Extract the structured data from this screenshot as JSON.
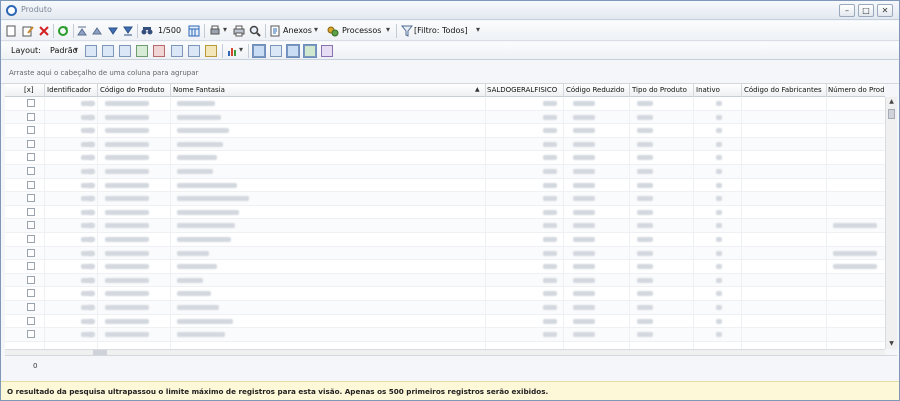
{
  "window": {
    "title": "Produto",
    "buttons": {
      "minimize": "–",
      "maximize": "□",
      "close": "✕"
    }
  },
  "toolbar": {
    "record_position": "1/500",
    "anexos": "Anexos",
    "processos": "Processos",
    "filter": "[Filtro: Todos]",
    "dropdown_arrow": "▾"
  },
  "toolbar2": {
    "layout_label": "Layout:",
    "layout_value": "Padrão"
  },
  "grid": {
    "group_hint": "Arraste aqui o cabeçalho de uma coluna para agrupar",
    "select_all": "[x]",
    "sort_indicator": "▲",
    "columns": [
      "Identificador",
      "Código do Produto",
      "Nome Fantasia",
      "SALDOGERALFISICO",
      "Código Reduzido",
      "Tipo do Produto",
      "Inativo",
      "Código do Fabricantes",
      "Número do Produto n"
    ],
    "row_count": 18,
    "footer_count": "0"
  },
  "status": {
    "message": "O resultado da pesquisa ultrapassou o limite máximo de registros para esta visão. Apenas os 500 primeiros registros serão exibidos."
  },
  "colors": {
    "status_bg": "#fdf8d8",
    "accent": "#2d67b6"
  }
}
